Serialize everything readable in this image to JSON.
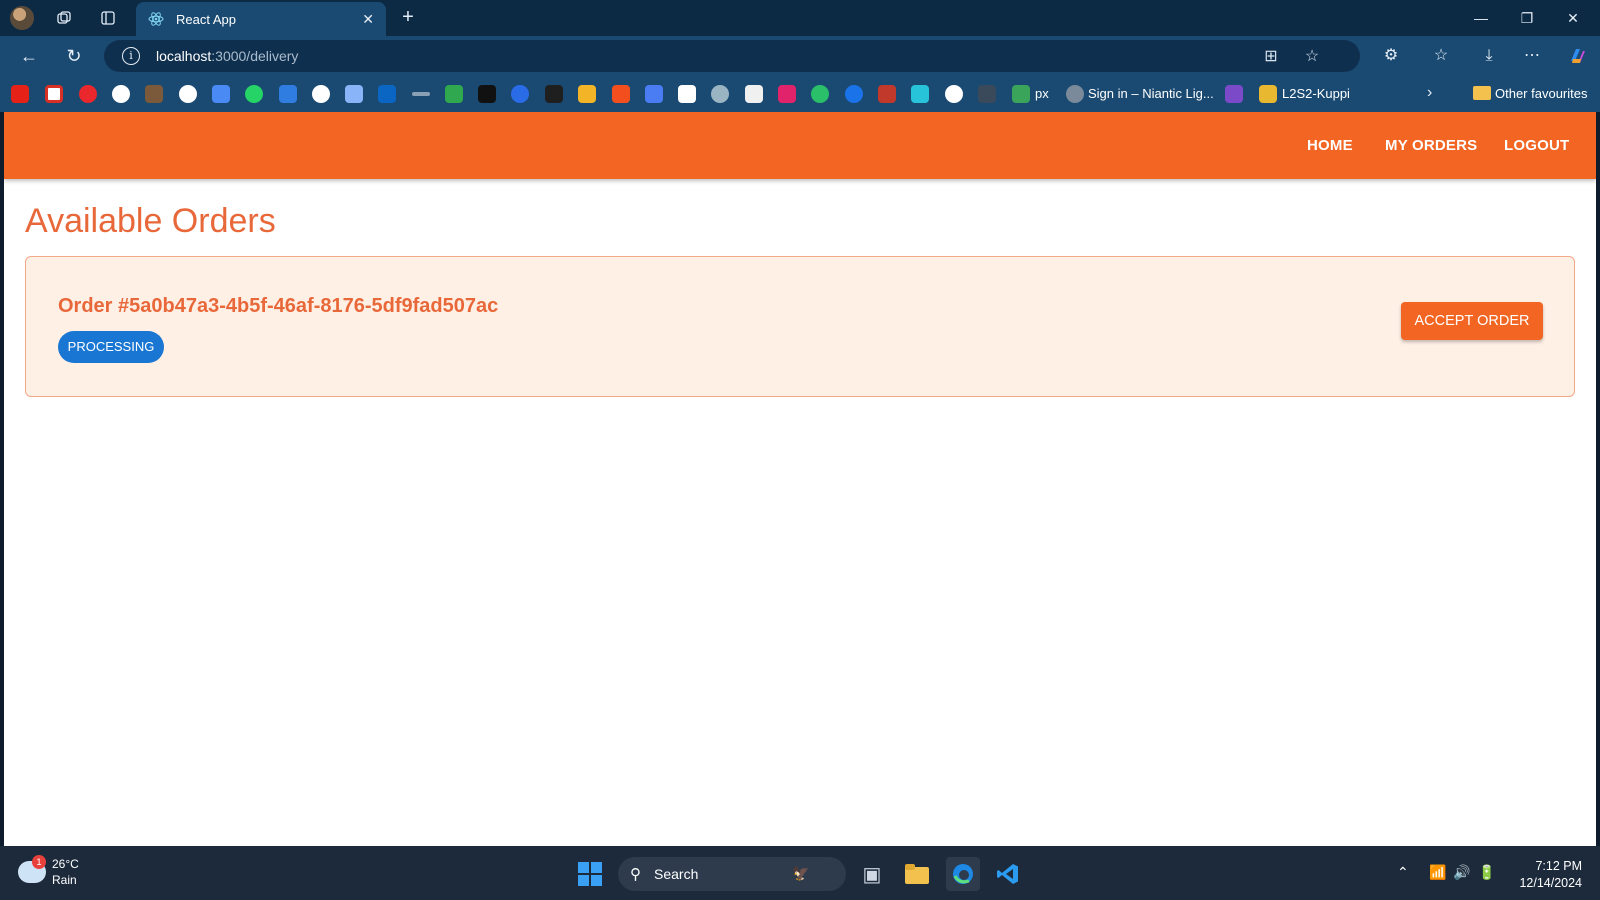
{
  "browser": {
    "tab_title": "React App",
    "url_host": "localhost",
    "url_rest": ":3000/delivery",
    "bookmarks": {
      "px_label": "px",
      "niantic_label": "Sign in – Niantic Lig...",
      "l2s2_label": "L2S2-Kuppi",
      "other_label": "Other favourites"
    }
  },
  "app": {
    "nav": {
      "home": "HOME",
      "my_orders": "MY ORDERS",
      "logout": "LOGOUT"
    },
    "page_title": "Available Orders",
    "orders": [
      {
        "title": "Order #5a0b47a3-4b5f-46af-8176-5df9fad507ac",
        "status": "PROCESSING",
        "action": "ACCEPT ORDER"
      }
    ]
  },
  "taskbar": {
    "weather_temp": "26°C",
    "weather_desc": "Rain",
    "weather_badge": "1",
    "search_label": "Search",
    "time": "7:12 PM",
    "date": "12/14/2024"
  },
  "colors": {
    "brand_orange": "#f26522",
    "title_orange": "#e8683a",
    "status_blue": "#1976d2",
    "card_bg": "#fff0e6"
  }
}
